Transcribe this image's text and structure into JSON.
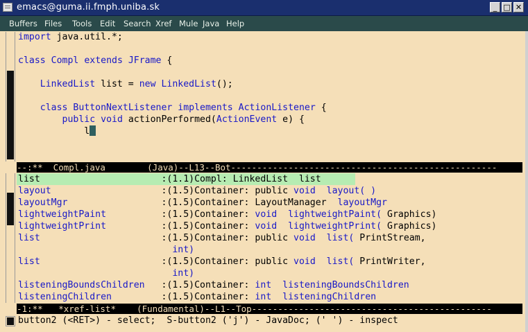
{
  "window": {
    "title": "emacs@guma.ii.fmph.uniba.sk",
    "buttons": [
      "_",
      "□",
      "✕"
    ]
  },
  "menu": [
    "Buffers",
    "Files",
    "Tools",
    "Edit",
    "Search",
    "Xref",
    "Mule",
    "Java",
    "Help"
  ],
  "editor": {
    "lines": [
      {
        "segments": [
          {
            "t": "import",
            "c": "kw"
          },
          {
            "t": " java.util.*;",
            "c": ""
          }
        ]
      },
      {
        "segments": []
      },
      {
        "segments": [
          {
            "t": "class",
            "c": "kw"
          },
          {
            "t": " ",
            "c": ""
          },
          {
            "t": "Compl",
            "c": "ty"
          },
          {
            "t": " ",
            "c": ""
          },
          {
            "t": "extends",
            "c": "kw"
          },
          {
            "t": " ",
            "c": ""
          },
          {
            "t": "JFrame",
            "c": "ty"
          },
          {
            "t": " {",
            "c": ""
          }
        ]
      },
      {
        "segments": []
      },
      {
        "segments": [
          {
            "t": "    ",
            "c": ""
          },
          {
            "t": "LinkedList",
            "c": "ty"
          },
          {
            "t": " list = ",
            "c": ""
          },
          {
            "t": "new",
            "c": "kw"
          },
          {
            "t": " ",
            "c": ""
          },
          {
            "t": "LinkedList",
            "c": "ty"
          },
          {
            "t": "();",
            "c": ""
          }
        ]
      },
      {
        "segments": []
      },
      {
        "segments": [
          {
            "t": "    ",
            "c": ""
          },
          {
            "t": "class",
            "c": "kw"
          },
          {
            "t": " ",
            "c": ""
          },
          {
            "t": "ButtonNextListener",
            "c": "ty"
          },
          {
            "t": " ",
            "c": ""
          },
          {
            "t": "implements",
            "c": "kw"
          },
          {
            "t": " ",
            "c": ""
          },
          {
            "t": "ActionListener",
            "c": "ty"
          },
          {
            "t": " {",
            "c": ""
          }
        ]
      },
      {
        "segments": [
          {
            "t": "        ",
            "c": ""
          },
          {
            "t": "public",
            "c": "kw"
          },
          {
            "t": " ",
            "c": ""
          },
          {
            "t": "void",
            "c": "kw"
          },
          {
            "t": " actionPerformed(",
            "c": ""
          },
          {
            "t": "ActionEvent",
            "c": "ty"
          },
          {
            "t": " e) {",
            "c": ""
          }
        ]
      },
      {
        "segments": [
          {
            "t": "            l",
            "c": ""
          }
        ],
        "cursor": true
      }
    ],
    "modeline": "--:**  Compl.java        (Java)--L13--Bot---------------------------------------------------"
  },
  "xref": {
    "rows": [
      {
        "name": "list",
        "rest": [
          {
            "t": ":(1.1)Compl: LinkedList  list",
            "c": ""
          }
        ],
        "highlight": true
      },
      {
        "name": "layout",
        "rest": [
          {
            "t": ":(1.5)Container: public ",
            "c": ""
          },
          {
            "t": "void",
            "c": "kw"
          },
          {
            "t": "  layout( )",
            "c": "kw"
          }
        ]
      },
      {
        "name": "layoutMgr",
        "rest": [
          {
            "t": ":(1.5)Container: LayoutManager  ",
            "c": ""
          },
          {
            "t": "layoutMgr",
            "c": "kw"
          }
        ]
      },
      {
        "name": "lightweightPaint",
        "rest": [
          {
            "t": ":(1.5)Container: ",
            "c": ""
          },
          {
            "t": "void",
            "c": "kw"
          },
          {
            "t": "  ",
            "c": ""
          },
          {
            "t": "lightweightPaint(",
            "c": "kw"
          },
          {
            "t": " Graphics)",
            "c": ""
          }
        ]
      },
      {
        "name": "lightweightPrint",
        "rest": [
          {
            "t": ":(1.5)Container: ",
            "c": ""
          },
          {
            "t": "void",
            "c": "kw"
          },
          {
            "t": "  ",
            "c": ""
          },
          {
            "t": "lightweightPrint(",
            "c": "kw"
          },
          {
            "t": " Graphics)",
            "c": ""
          }
        ]
      },
      {
        "name": "list",
        "rest": [
          {
            "t": ":(1.5)Container: public ",
            "c": ""
          },
          {
            "t": "void",
            "c": "kw"
          },
          {
            "t": "  ",
            "c": ""
          },
          {
            "t": "list(",
            "c": "kw"
          },
          {
            "t": " PrintStream,",
            "c": ""
          }
        ]
      },
      {
        "name": "",
        "rest": [
          {
            "t": "  int)",
            "c": "kw"
          }
        ],
        "cont": true
      },
      {
        "name": "list",
        "rest": [
          {
            "t": ":(1.5)Container: public ",
            "c": ""
          },
          {
            "t": "void",
            "c": "kw"
          },
          {
            "t": "  ",
            "c": ""
          },
          {
            "t": "list(",
            "c": "kw"
          },
          {
            "t": " PrintWriter,",
            "c": ""
          }
        ]
      },
      {
        "name": "",
        "rest": [
          {
            "t": "  int)",
            "c": "kw"
          }
        ],
        "cont": true
      },
      {
        "name": "listeningBoundsChildren",
        "rest": [
          {
            "t": ":(1.5)Container: ",
            "c": ""
          },
          {
            "t": "int",
            "c": "kw"
          },
          {
            "t": "  ",
            "c": ""
          },
          {
            "t": "listeningBoundsChildren",
            "c": "kw"
          }
        ]
      },
      {
        "name": "listeningChildren",
        "rest": [
          {
            "t": ":(1.5)Container: ",
            "c": ""
          },
          {
            "t": "int",
            "c": "kw"
          },
          {
            "t": "  ",
            "c": ""
          },
          {
            "t": "listeningChildren",
            "c": "kw"
          }
        ]
      }
    ],
    "modeline": "-1:**   *xref-list*    (Fundamental)--L1--Top----------------------------------------------"
  },
  "minibuffer": "button2 (<RET>) - select;  S-button2 ('j') - JavaDoc; (' ') - inspect",
  "colors": {
    "keyword": "#1818c8",
    "background": "#f5dfb8",
    "highlight": "#b6ecb2",
    "menubar": "#2a4a4a",
    "titlebar": "#1a2f6e"
  }
}
